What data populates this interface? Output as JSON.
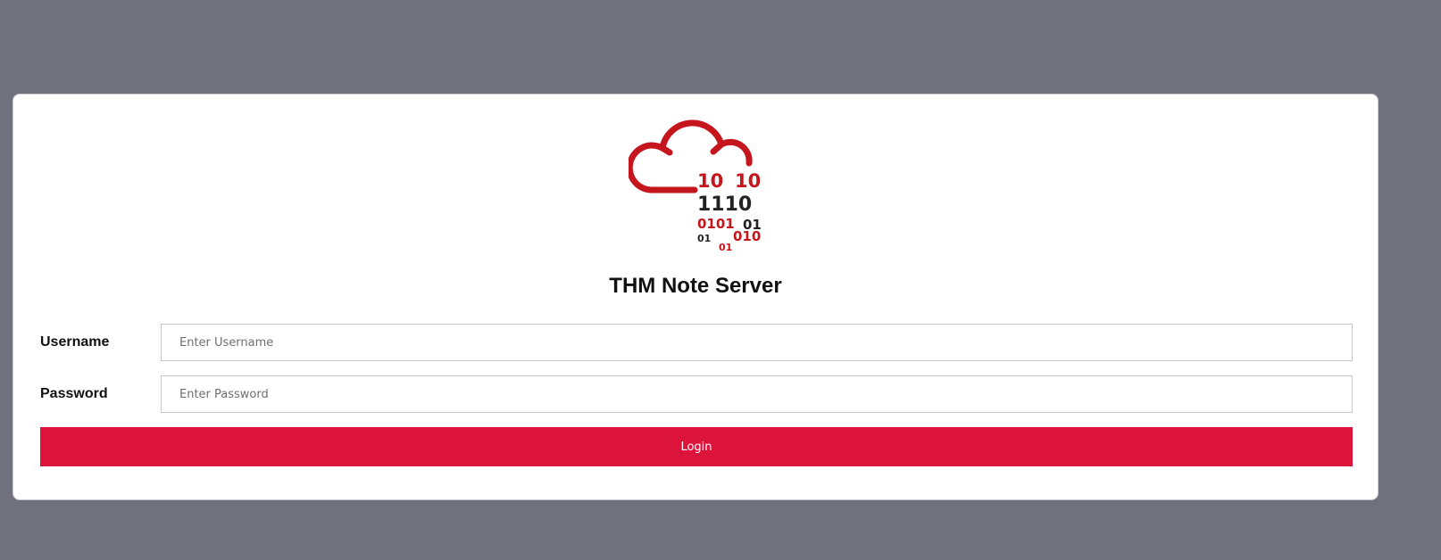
{
  "app": {
    "title": "THM Note Server",
    "logo_digits": {
      "row1_left": "10",
      "row1_right": "10",
      "row2": "1110",
      "row3_left": "0101",
      "row3_right": "01",
      "row4_left": "01",
      "row4_right": "010",
      "row5": "01"
    }
  },
  "form": {
    "username_label": "Username",
    "username_placeholder": "Enter Username",
    "username_value": "",
    "password_label": "Password",
    "password_placeholder": "Enter Password",
    "password_value": "",
    "login_label": "Login"
  },
  "colors": {
    "background": "#71717d",
    "accent": "#dc143c",
    "logo_red": "#c4161c",
    "logo_dark": "#222222"
  }
}
